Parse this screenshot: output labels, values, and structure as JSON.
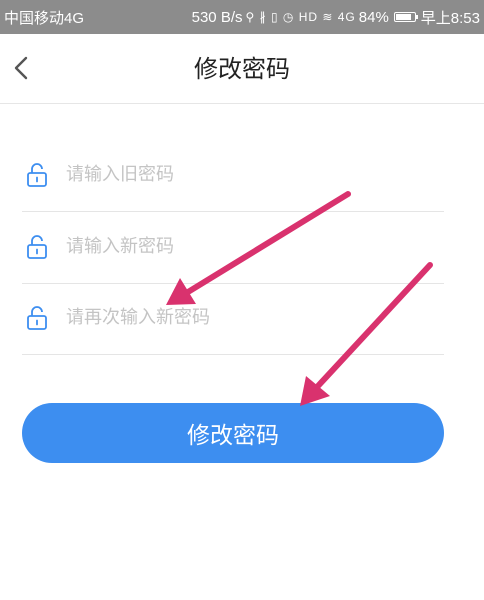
{
  "status_bar": {
    "carrier": "中国移动4G",
    "speed": "530 B/s",
    "icons_text": "⚲ ∦ ▯ ◷ HD ≋ 4G",
    "battery": "84%",
    "time": "早上8:53"
  },
  "navbar": {
    "back_icon": "chevron-left-icon",
    "title": "修改密码"
  },
  "form": {
    "old_password_placeholder": "请输入旧密码",
    "new_password_placeholder": "请输入新密码",
    "confirm_password_placeholder": "请再次输入新密码",
    "lock_icon": "lock-icon"
  },
  "submit_label": "修改密码",
  "colors": {
    "accent": "#3d8ef0",
    "annotation_arrow": "#d9326e",
    "status_bar": "#8c8c8c"
  }
}
